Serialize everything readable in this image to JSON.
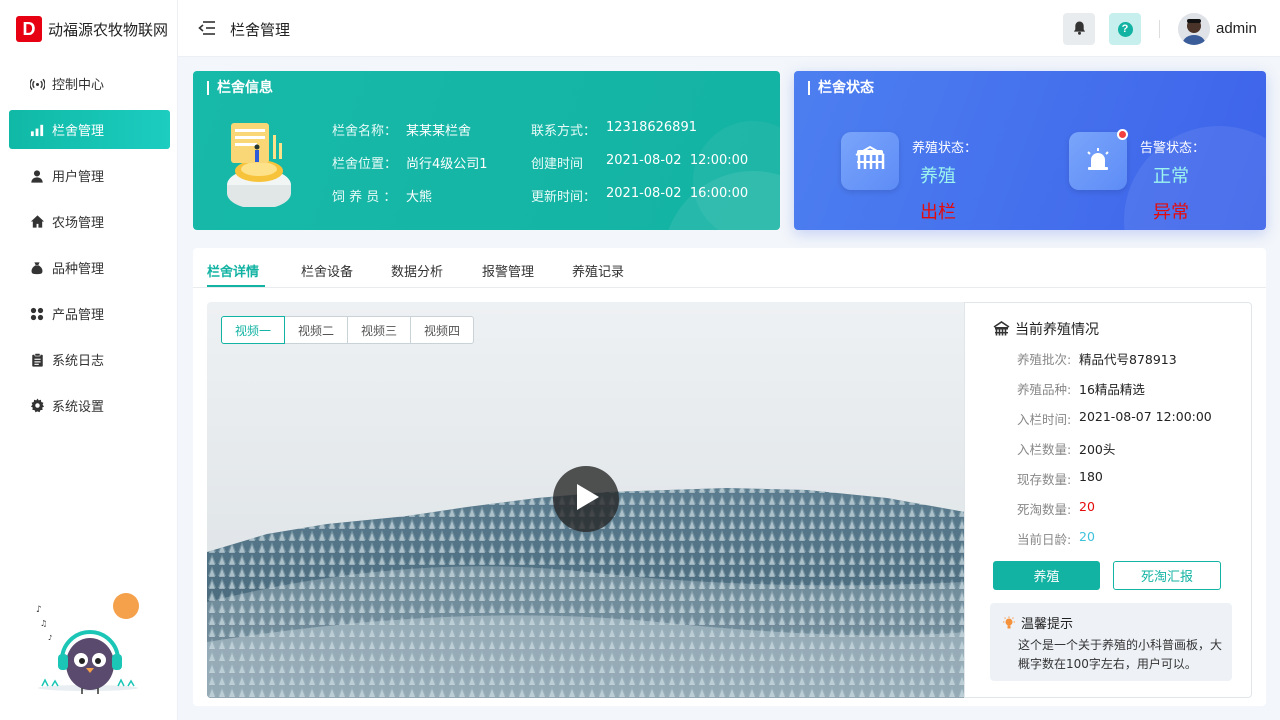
{
  "app": {
    "logo_letter": "D",
    "name": "动福源农牧物联网"
  },
  "sidebar": {
    "items": [
      {
        "label": "控制中心",
        "icon": "radar-icon"
      },
      {
        "label": "栏舍管理",
        "icon": "bar-chart-icon",
        "active": true
      },
      {
        "label": "用户管理",
        "icon": "user-icon"
      },
      {
        "label": "农场管理",
        "icon": "home-icon"
      },
      {
        "label": "品种管理",
        "icon": "bag-icon"
      },
      {
        "label": "产品管理",
        "icon": "grid-icon"
      },
      {
        "label": "系统日志",
        "icon": "clipboard-icon"
      },
      {
        "label": "系统设置",
        "icon": "gear-icon"
      }
    ]
  },
  "header": {
    "title": "栏舍管理",
    "username": "admin",
    "help_glyph": "?"
  },
  "pen_info": {
    "title": "栏舍信息",
    "fields": [
      {
        "label": "栏舍名称：",
        "value": "某某某栏舍"
      },
      {
        "label": "栏舍位置：",
        "value": "尚行4级公司1"
      },
      {
        "label": "饲 养 员 ：",
        "value": "大熊"
      },
      {
        "label": "联系方式：",
        "value": "12318626891"
      },
      {
        "label": "创建时间",
        "value": "2021-08-02  12:00:00"
      },
      {
        "label": "更新时间：",
        "value": "2021-08-02  16:00:00"
      }
    ]
  },
  "pen_status": {
    "title": "栏舍状态",
    "breeding": {
      "label": "养殖状态：",
      "normal": "养殖",
      "abnormal": "出栏"
    },
    "alarm": {
      "label": "告警状态：",
      "normal": "正常",
      "abnormal": "异常"
    }
  },
  "tabs": [
    {
      "label": "栏舍详情",
      "active": true
    },
    {
      "label": "栏舍设备"
    },
    {
      "label": "数据分析"
    },
    {
      "label": "报警管理"
    },
    {
      "label": "养殖记录"
    }
  ],
  "video": {
    "tabs": [
      {
        "label": "视频一",
        "active": true
      },
      {
        "label": "视频二"
      },
      {
        "label": "视频三"
      },
      {
        "label": "视频四"
      }
    ]
  },
  "breeding_info": {
    "title": "当前养殖情况",
    "rows": [
      {
        "label": "养殖批次:",
        "value": "精品代号878913"
      },
      {
        "label": "养殖品种:",
        "value": "16精品精选"
      },
      {
        "label": "入栏时间:",
        "value": "2021-08-07 12:00:00"
      },
      {
        "label": "入栏数量:",
        "value": "200头"
      },
      {
        "label": "现存数量:",
        "value": "180"
      },
      {
        "label": "死淘数量:",
        "value": "20",
        "highlight": "red"
      },
      {
        "label": "当前日龄:",
        "value": "20",
        "highlight": "cyan"
      }
    ],
    "primary_button": "养殖",
    "secondary_button": "死淘汇报"
  },
  "tip": {
    "title": "温馨提示",
    "text": "这个是一个关于养殖的小科普画板，大概字数在100字左右，用户可以。"
  },
  "colors": {
    "accent": "#13b3a3",
    "status_blue": "#3d63ea",
    "danger": "#e60b0b"
  }
}
